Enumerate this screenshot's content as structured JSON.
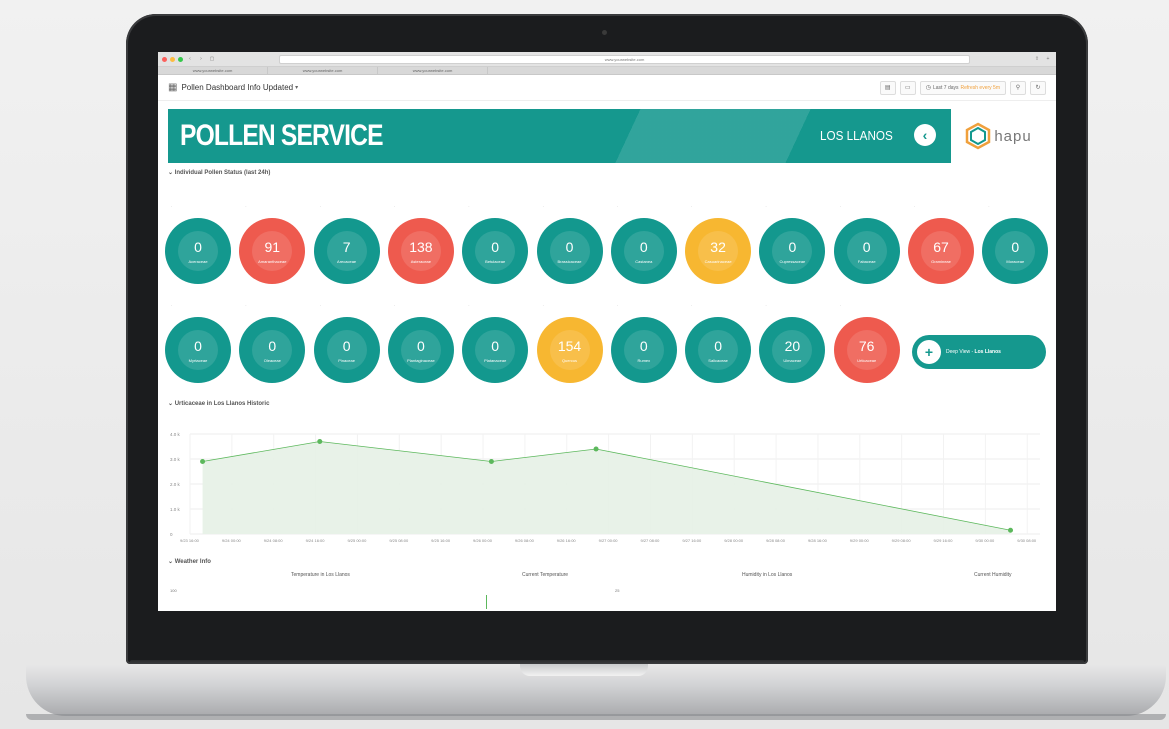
{
  "browser": {
    "url": "www.yourwebsite.com",
    "tabs": [
      "www.yourwebsite.com",
      "www.yourwebsite.com",
      "www.yourwebsite.com"
    ]
  },
  "toolbar": {
    "title": "Pollen Dashboard Info Updated",
    "time_range": "Last 7 days",
    "refresh": "Refresh every 5m"
  },
  "banner": {
    "title": "POLLEN SERVICE",
    "location": "LOS LLANOS",
    "logo_text": "hapu"
  },
  "sections": {
    "individual": "Individual Pollen Status (last 24h)",
    "historic": "Urticaceae in Los Llanos Historic",
    "weather": "Weather Info"
  },
  "pollen_row1": [
    {
      "value": "0",
      "name": "Aceraceae",
      "color": "#13988e"
    },
    {
      "value": "91",
      "name": "Amaranthaceae",
      "color": "#ee5a4e"
    },
    {
      "value": "7",
      "name": "Arecaceae",
      "color": "#13988e"
    },
    {
      "value": "138",
      "name": "Asteraceae",
      "color": "#ee5a4e"
    },
    {
      "value": "0",
      "name": "Betulaceae",
      "color": "#13988e"
    },
    {
      "value": "0",
      "name": "Brassicaceae",
      "color": "#13988e"
    },
    {
      "value": "0",
      "name": "Castanea",
      "color": "#13988e"
    },
    {
      "value": "32",
      "name": "Casuarinaceae",
      "color": "#f7b731"
    },
    {
      "value": "0",
      "name": "Cupressaceae",
      "color": "#13988e"
    },
    {
      "value": "0",
      "name": "Fabaceae",
      "color": "#13988e"
    },
    {
      "value": "67",
      "name": "Gramineae",
      "color": "#ee5a4e"
    },
    {
      "value": "0",
      "name": "Moraceae",
      "color": "#13988e"
    }
  ],
  "pollen_row2": [
    {
      "value": "0",
      "name": "Myrtaceae",
      "color": "#13988e"
    },
    {
      "value": "0",
      "name": "Oleaceae",
      "color": "#13988e"
    },
    {
      "value": "0",
      "name": "Pinaceae",
      "color": "#13988e"
    },
    {
      "value": "0",
      "name": "Plantaginaceae",
      "color": "#13988e"
    },
    {
      "value": "0",
      "name": "Platanaceae",
      "color": "#13988e"
    },
    {
      "value": "154",
      "name": "Quercus",
      "color": "#f7b731"
    },
    {
      "value": "0",
      "name": "Rumex",
      "color": "#13988e"
    },
    {
      "value": "0",
      "name": "Salicaceae",
      "color": "#13988e"
    },
    {
      "value": "20",
      "name": "Ulmaceae",
      "color": "#13988e"
    },
    {
      "value": "76",
      "name": "Urticaceae",
      "color": "#ee5a4e"
    }
  ],
  "deep_view": {
    "prefix": "Deep View - ",
    "place": "Los Llanos"
  },
  "chart_data": {
    "type": "area",
    "title": "Urticaceae in Los Llanos Historic",
    "y_ticks": [
      "0",
      "1.0 k",
      "2.0 k",
      "3.0 k",
      "4.0 k"
    ],
    "ylim": [
      0,
      4000
    ],
    "x_labels": [
      "9/23 16:00",
      "9/24 00:00",
      "9/24 08:00",
      "9/24 16:00",
      "9/25 00:00",
      "9/25 08:00",
      "9/25 16:00",
      "9/26 00:00",
      "9/26 08:00",
      "9/26 16:00",
      "9/27 00:00",
      "9/27 08:00",
      "9/27 16:00",
      "9/28 00:00",
      "9/28 08:00",
      "9/28 16:00",
      "9/29 00:00",
      "9/29 08:00",
      "9/29 16:00",
      "9/30 00:00",
      "9/30 08:00"
    ],
    "series": [
      {
        "x_index": [
          0.3,
          3.1,
          7.2,
          9.7,
          19.6
        ],
        "values": [
          2900,
          3700,
          2900,
          3400,
          150
        ]
      }
    ],
    "grid": true,
    "colors": {
      "line": "#5cb85c",
      "fill": "#e6f1e6"
    }
  },
  "weather": {
    "headers": [
      "Temperature in Los Llanos",
      "Current Temperature",
      "Humidity in Los Llanos",
      "Current Humidity"
    ],
    "values": [
      "100",
      "25"
    ]
  }
}
